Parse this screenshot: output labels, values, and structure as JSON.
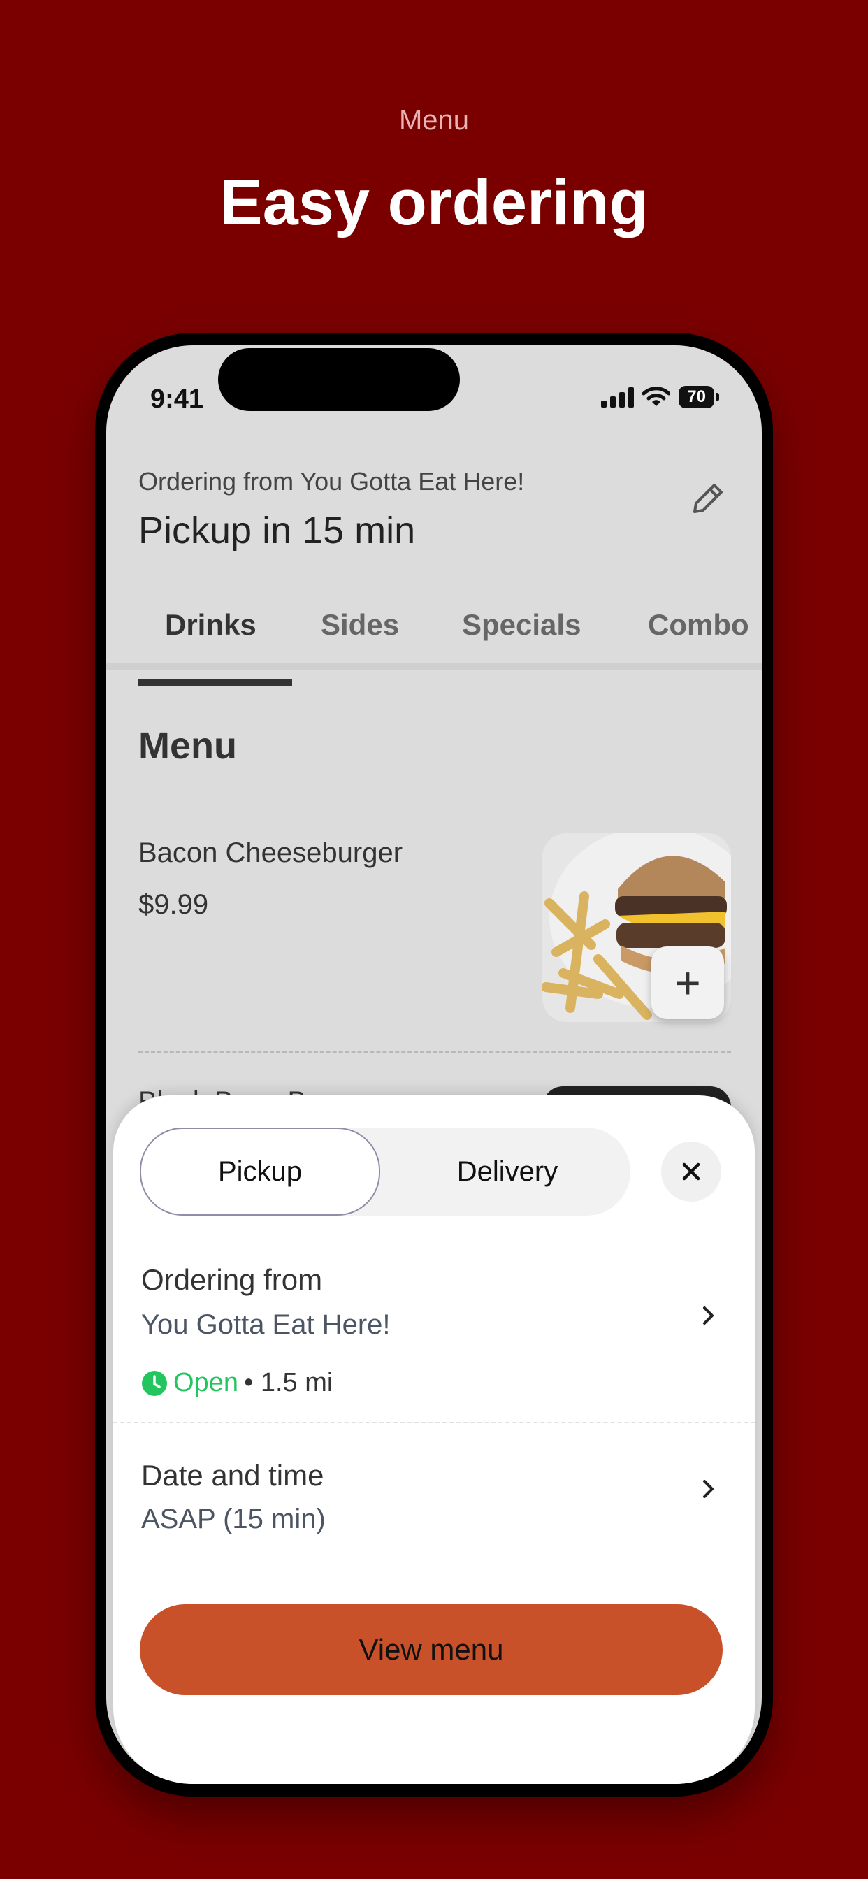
{
  "hero": {
    "subtitle": "Menu",
    "title": "Easy ordering"
  },
  "status_bar": {
    "time": "9:41",
    "battery": "70"
  },
  "header": {
    "ordering_from": "Ordering from You Gotta Eat Here!",
    "pickup_time": "Pickup in 15 min",
    "edit_icon": "pencil-icon"
  },
  "tabs": [
    {
      "label": "Drinks",
      "active": true
    },
    {
      "label": "Sides",
      "active": false
    },
    {
      "label": "Specials",
      "active": false
    },
    {
      "label": "Combo",
      "active": false
    }
  ],
  "menu": {
    "title": "Menu",
    "items": [
      {
        "name": "Bacon Cheeseburger",
        "price": "$9.99",
        "add_label": "+"
      }
    ],
    "partial_item": "Black Bean B"
  },
  "sheet": {
    "segments": {
      "pickup": "Pickup",
      "delivery": "Delivery",
      "selected": "Pickup"
    },
    "close_icon": "close-icon",
    "ordering_from_title": "Ordering from",
    "location": "You Gotta Eat Here!",
    "status": "Open",
    "distance": "• 1.5 mi",
    "date_time_title": "Date and time",
    "date_time_value": "ASAP (15 min)",
    "view_menu": "View menu"
  },
  "colors": {
    "background": "#7a0000",
    "accent": "#c9512a",
    "open_green": "#22c55e"
  }
}
